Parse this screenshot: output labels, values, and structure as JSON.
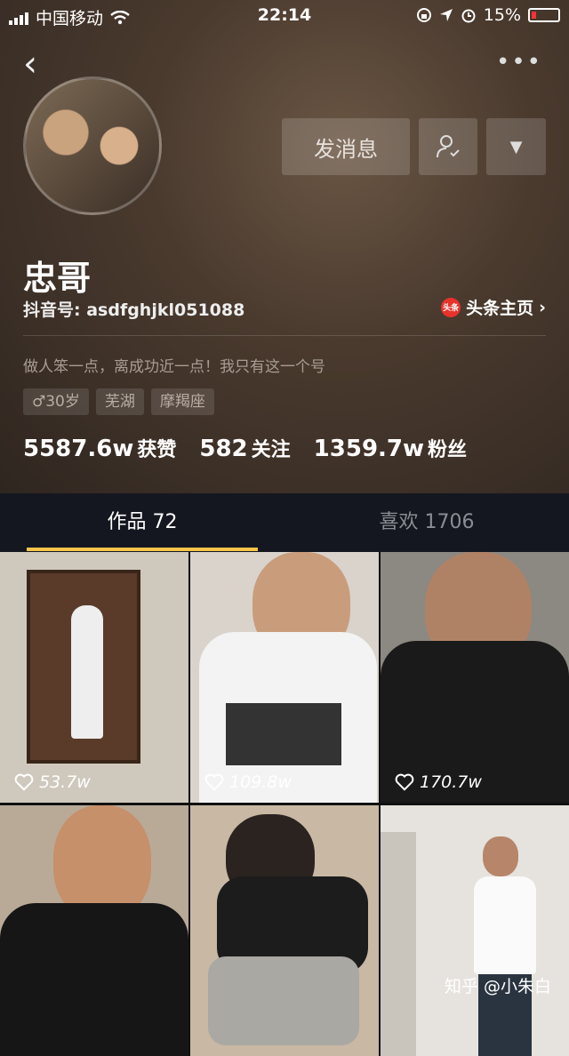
{
  "status_bar": {
    "carrier": "中国移动",
    "time": "22:14",
    "battery": "15%"
  },
  "profile": {
    "name": "忠哥",
    "douyin_id": "抖音号: asdfghjkl051088",
    "toutiao_link": "头条主页",
    "toutiao_logo_text": "头条",
    "bio": "做人笨一点，离成功近一点！我只有这一个号",
    "tags": [
      "♂30岁",
      "芜湖",
      "摩羯座"
    ],
    "message_button": "发消息",
    "stats": [
      {
        "num": "5587.6w",
        "label": "获赞"
      },
      {
        "num": "582",
        "label": "关注"
      },
      {
        "num": "1359.7w",
        "label": "粉丝"
      }
    ]
  },
  "tabs": {
    "works": "作品 72",
    "likes": "喜欢 1706"
  },
  "videos": [
    {
      "likes": "53.7w",
      "bg": "#cfc8bd"
    },
    {
      "likes": "109.8w",
      "bg": "#d9d3cc"
    },
    {
      "likes": "170.7w",
      "bg": "#8c8882"
    },
    {
      "likes": "",
      "bg": "#b9aa98"
    },
    {
      "likes": "",
      "bg": "#c8b8a4"
    },
    {
      "likes": "",
      "bg": "#e6e3de"
    }
  ],
  "watermark": "知乎 @小朱白"
}
